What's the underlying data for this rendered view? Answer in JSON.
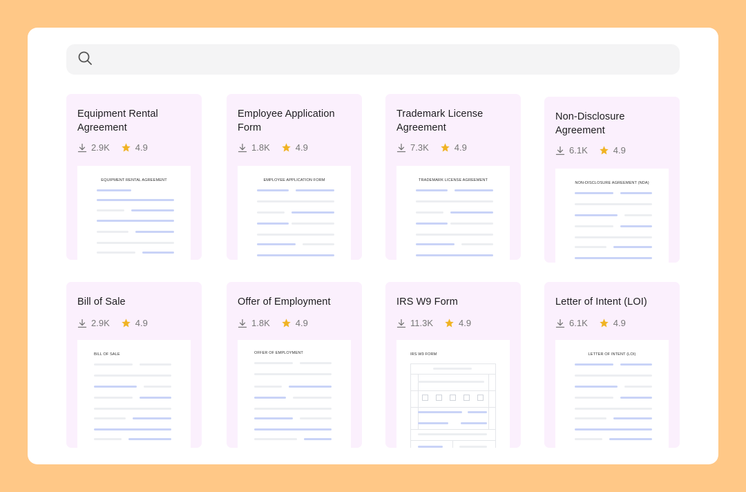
{
  "search": {
    "placeholder": "",
    "value": ""
  },
  "cards": [
    {
      "title": "Equipment Rental Agreement",
      "downloads": "2.9K",
      "rating": "4.9",
      "doc_title": "EQUIPMENT RENTAL AGREEMENT"
    },
    {
      "title": "Employee Application Form",
      "downloads": "1.8K",
      "rating": "4.9",
      "doc_title": "EMPLOYEE APPLICATION FORM"
    },
    {
      "title": "Trademark License Agreement",
      "downloads": "7.3K",
      "rating": "4.9",
      "doc_title": "TRADEMARK LICENSE AGREEMENT"
    },
    {
      "title": "Non-Disclosure Agreement",
      "downloads": "6.1K",
      "rating": "4.9",
      "doc_title": "NON-DISCLOSURE AGREEMENT (NDA)"
    },
    {
      "title": "Bill of Sale",
      "downloads": "2.9K",
      "rating": "4.9",
      "doc_title": "BILL OF SALE"
    },
    {
      "title": "Offer of Employment",
      "downloads": "1.8K",
      "rating": "4.9",
      "doc_title": "OFFER OF EMPLOYMENT"
    },
    {
      "title": "IRS W9 Form",
      "downloads": "11.3K",
      "rating": "4.9",
      "doc_title": "IRS W9 FORM"
    },
    {
      "title": "Letter of Intent (LOI)",
      "downloads": "6.1K",
      "rating": "4.9",
      "doc_title": "LETTER OF INTENT (LOI)"
    }
  ],
  "colors": {
    "background": "#ffc887",
    "card": "#fbf0fd",
    "star": "#f0b323",
    "line_blue": "#c9d3f7",
    "line_gray": "#eceef1"
  },
  "icons": {
    "search": "search-icon",
    "downloads": "download-icon",
    "rating": "star-icon"
  }
}
